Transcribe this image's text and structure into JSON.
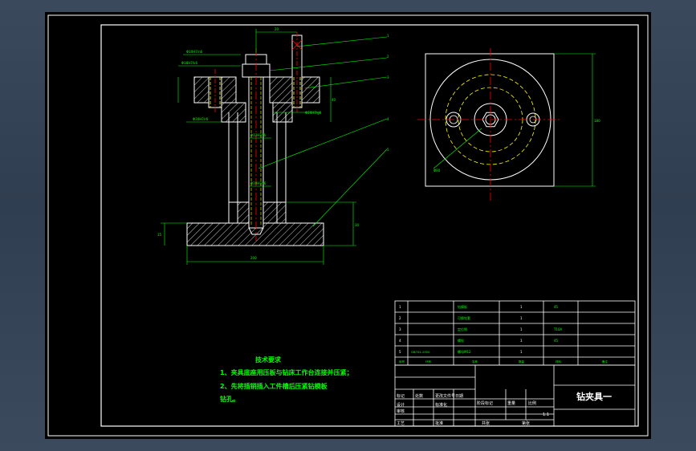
{
  "colors": {
    "sheet": "#000000",
    "frame": "#ffffff",
    "part": "#ffffff",
    "dimension": "#00ff00",
    "centerline": "#ff0000",
    "hatch": "#ffffff",
    "hidden": "#ffff00",
    "hole_circle": "#00ffff",
    "background": "#34445a"
  },
  "notes": {
    "heading": "技术要求",
    "line1": "1、夹具底座用压板与钻床工作台连接并压紧；",
    "line2": "2、先将插销插入工件槽后压紧钻模板",
    "line3": "钻孔。"
  },
  "title_block": {
    "drawing_name": "钻夹具一",
    "scale": "1:1",
    "labels": {
      "mark": "标记",
      "count": "处数",
      "zone": "分区",
      "change_doc": "更改文件号",
      "signature": "签名",
      "date": "日期",
      "stage_mark": "阶段标记",
      "weight": "重量",
      "ratio": "比例",
      "design": "设计",
      "standardize": "标准化",
      "review": "审核",
      "process": "工艺",
      "approve": "批准",
      "total": "共张",
      "sheet": "第张"
    }
  },
  "bom": {
    "rows": [
      {
        "no": "1",
        "code": "",
        "name": "钻模板",
        "qty": "1",
        "material": "45",
        "note": ""
      },
      {
        "no": "2",
        "code": "",
        "name": "可换钻套",
        "qty": "1",
        "material": "",
        "note": ""
      },
      {
        "no": "3",
        "code": "",
        "name": "定位销",
        "qty": "1",
        "material": "T10A",
        "note": ""
      },
      {
        "no": "4",
        "code": "",
        "name": "螺栓",
        "qty": "1",
        "material": "45",
        "note": ""
      },
      {
        "no": "5",
        "code": "GB/T41-2000",
        "name": "螺母M12",
        "qty": "1",
        "material": "",
        "note": ""
      }
    ],
    "header": {
      "no": "序号",
      "code": "代号",
      "name": "名称",
      "qty": "数量",
      "material": "材料",
      "note": "备注"
    }
  },
  "leaders": [
    "1",
    "2",
    "3",
    "4",
    "5"
  ],
  "dims": {
    "top_w": "20",
    "d1": "Φ10H7/n6",
    "d2": "Φ18H7/k6",
    "d3": "Φ30H7/r6",
    "d4": "Φ20H7/g6",
    "d5": "Φ12H7/f6",
    "d6": "Φ30H7/r6",
    "d7": "Φ8H7/n6",
    "h1": "40",
    "base_w": "200",
    "base_h": "15",
    "base_h2": "30",
    "side_h": "180",
    "dia": "Φ80"
  }
}
